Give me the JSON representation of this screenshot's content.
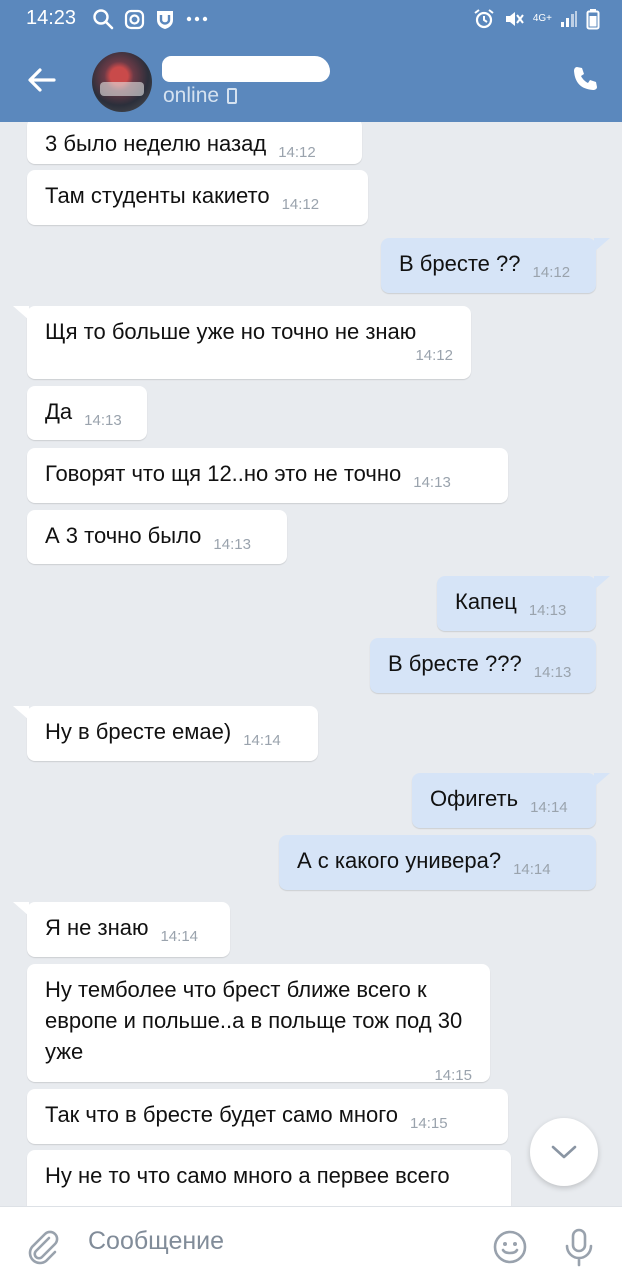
{
  "status_bar": {
    "time": "14:23",
    "network": "4G+"
  },
  "header": {
    "presence": "online"
  },
  "colors": {
    "header": "#5b88bd",
    "incoming": "#ffffff",
    "outgoing": "#d6e4f7",
    "background": "#e8ebef"
  },
  "messages": [
    {
      "dir": "in",
      "text": "3 было неделю назад",
      "time": "14:12"
    },
    {
      "dir": "in",
      "text": "Там студенты какието",
      "time": "14:12"
    },
    {
      "dir": "out",
      "text": "В бресте ??",
      "time": "14:12"
    },
    {
      "dir": "in",
      "text": "Щя то больше уже но точно не знаю",
      "time": "14:12"
    },
    {
      "dir": "in",
      "text": "Да",
      "time": "14:13"
    },
    {
      "dir": "in",
      "text": "Говорят что щя 12..но это не точно",
      "time": "14:13"
    },
    {
      "dir": "in",
      "text": "А 3 точно было",
      "time": "14:13"
    },
    {
      "dir": "out",
      "text": "Капец",
      "time": "14:13"
    },
    {
      "dir": "out",
      "text": "В бресте ???",
      "time": "14:13"
    },
    {
      "dir": "in",
      "text": "Ну в бресте емае)",
      "time": "14:14"
    },
    {
      "dir": "out",
      "text": "Офигеть",
      "time": "14:14"
    },
    {
      "dir": "out",
      "text": "А с какого универа?",
      "time": "14:14"
    },
    {
      "dir": "in",
      "text": "Я не знаю",
      "time": "14:14"
    },
    {
      "dir": "in",
      "text": "Ну темболее что брест ближе всего к европе и польше..а в польще тож под 30 уже",
      "time": "14:15"
    },
    {
      "dir": "in",
      "text": "Так что в бресте будет само много",
      "time": "14:15"
    },
    {
      "dir": "in",
      "text": "Ну не то что само много а первее всего",
      "time": ""
    }
  ],
  "composer": {
    "placeholder": "Сообщение"
  },
  "icons": {
    "back": "arrow-left-icon",
    "call": "phone-icon",
    "attach": "paperclip-icon",
    "emoji": "smile-icon",
    "voice": "microphone-icon",
    "scroll": "chevron-down-icon"
  }
}
